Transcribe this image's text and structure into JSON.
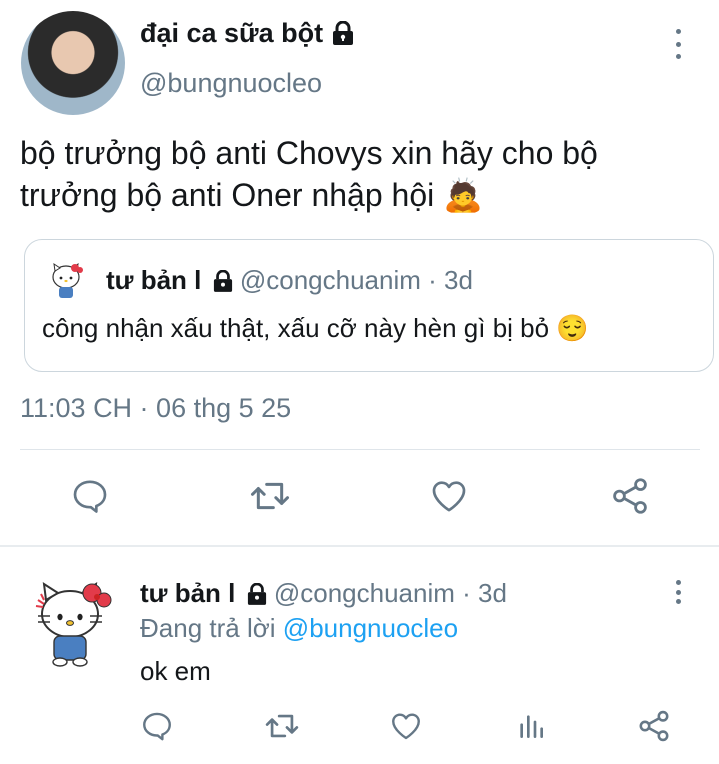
{
  "main_tweet": {
    "display_name": "đại ca sữa bột",
    "handle": "@bungnuocleo",
    "text_line1": "bộ trưởng bộ anti Chovys xin hãy cho bộ",
    "text_line2": "trưởng bộ anti Oner nhập hội",
    "emoji": "🙇",
    "timestamp": "11:03 CH · 06 thg 5 25"
  },
  "quoted_tweet": {
    "display_name": "tư bản l",
    "handle": "@congchuanim",
    "age": "· 3d",
    "text": "công nhận xấu thật, xấu cỡ này hèn gì bị bỏ",
    "emoji": "😌"
  },
  "reply": {
    "display_name": "tư bản l",
    "handle": "@congchuanim",
    "age": "· 3d",
    "replying_prefix": "Đang trả lời",
    "replying_to": "@bungnuocleo",
    "text": "ok em"
  },
  "icons": {
    "reply": "reply-icon",
    "retweet": "retweet-icon",
    "like": "heart-icon",
    "share": "share-icon",
    "analytics": "analytics-icon",
    "lock": "lock-icon",
    "more": "more-options-icon"
  },
  "colors": {
    "text": "#14171a",
    "secondary": "#657786",
    "link": "#1da1f2",
    "border": "#ccd6dd"
  }
}
